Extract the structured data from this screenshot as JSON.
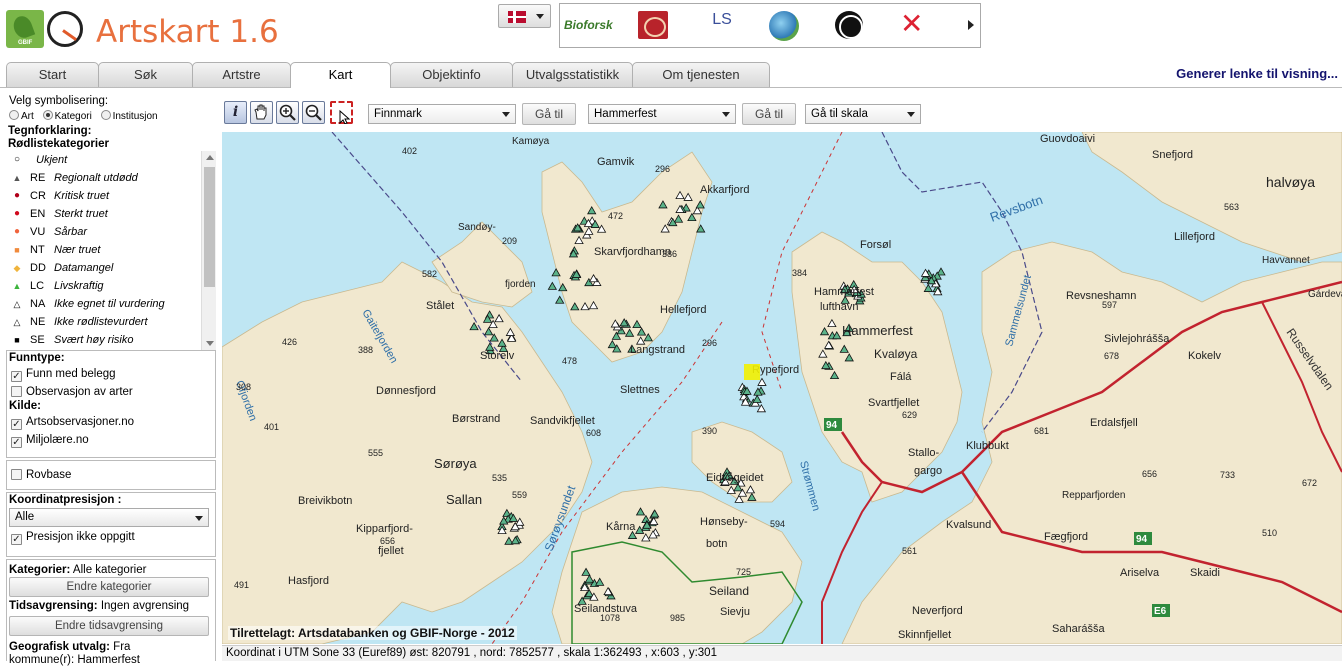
{
  "header": {
    "app_title": "Artskart 1.6",
    "gbif_text": "GBIF",
    "partners_label_bioforsk": "Bioforsk",
    "partners_label_ls": "LS",
    "share_link": "Generer lenke til visning..."
  },
  "tabs": [
    {
      "label": "Start"
    },
    {
      "label": "Søk"
    },
    {
      "label": "Artstre"
    },
    {
      "label": "Kart"
    },
    {
      "label": "Objektinfo"
    },
    {
      "label": "Utvalgsstatistikk"
    },
    {
      "label": "Om tjenesten"
    }
  ],
  "active_tab": "Kart",
  "sidebar": {
    "symbolisering_label": "Velg symbolisering:",
    "radio_art": "Art",
    "radio_kategori": "Kategori",
    "radio_institusjon": "Institusjon",
    "radio_selected": "Kategori",
    "legend_title": "Tegnforklaring:",
    "legend_subtitle": "Rødlistekategorier",
    "legend_items": [
      {
        "code": "",
        "desc": "Ukjent",
        "color": "#ffffff"
      },
      {
        "code": "RE",
        "desc": "Regionalt utdødd",
        "color": "#555555"
      },
      {
        "code": "CR",
        "desc": "Kritisk truet",
        "color": "#b0001a"
      },
      {
        "code": "EN",
        "desc": "Sterkt truet",
        "color": "#d10a1e"
      },
      {
        "code": "VU",
        "desc": "Sårbar",
        "color": "#f0643c"
      },
      {
        "code": "NT",
        "desc": "Nær truet",
        "color": "#f08a3c"
      },
      {
        "code": "DD",
        "desc": "Datamangel",
        "color": "#f0b43c"
      },
      {
        "code": "LC",
        "desc": "Livskraftig",
        "color": "#3cb43c"
      },
      {
        "code": "NA",
        "desc": "Ikke egnet til vurdering",
        "color": "#ffffff"
      },
      {
        "code": "NE",
        "desc": "Ikke rødlistevurdert",
        "color": "#ffffff"
      },
      {
        "code": "SE",
        "desc": "Svært høy risiko",
        "color": "#000000"
      }
    ],
    "funntype_title": "Funntype:",
    "funn_med_belegg": "Funn med belegg",
    "observasjon_av_arter": "Observasjon av arter",
    "kilde_title": "Kilde:",
    "kilde_artsobs": "Artsobservasjoner.no",
    "kilde_miljolare": "Miljolære.no",
    "rovbase": "Rovbase",
    "koordinat_title": "Koordinatpresisjon :",
    "koordinat_value": "Alle",
    "presisjon_ikke_oppgitt": "Presisjon ikke oppgitt",
    "kategorier_label": "Kategorier:",
    "kategorier_value": "Alle kategorier",
    "endre_kategorier": "Endre kategorier",
    "tidsavgrensing_label": "Tidsavgrensing:",
    "tidsavgrensing_value": "Ingen avgrensing",
    "endre_tidsavgrensing": "Endre tidsavgrensing",
    "geografisk_label": "Geografisk utvalg:",
    "geografisk_value": "Fra",
    "kommune_line": "kommune(r): Hammerfest"
  },
  "toolbar": {
    "info_icon_glyph": "i",
    "county_select": "Finnmark",
    "goto1": "Gå til",
    "municipality_select": "Hammerfest",
    "goto2": "Gå til",
    "scale_select": "Gå til skala"
  },
  "map": {
    "credit": "Tilrettelagt: Artsdatabanken og GBIF-Norge - 2012",
    "status": "Koordinat i UTM Sone 33 (Euref89) øst: 820791 , nord: 7852577 , skala 1:362493 , x:603 , y:301",
    "place_labels": {
      "kamoya": "Kamøya",
      "gamvik": "Gamvik",
      "akkarfjord": "Akkarfjord",
      "sandoy": "Sandøy-",
      "fjorden": "fjorden",
      "skarvfjordhamn": "Skarvfjordhamn",
      "hellefjord": "Hellefjord",
      "stalet": "Stålet",
      "langstrand": "Langstrand",
      "storelv": "Storelv",
      "slettnes": "Slettnes",
      "donnesfjord": "Dønnesfjord",
      "borstrand": "Børstrand",
      "sandvikfjellet": "Sandvikfjellet",
      "soroya": "Sørøya",
      "sallan": "Sallan",
      "breivikbotn": "Breivikbotn",
      "kipparfjord": "Kipparfjord-",
      "fjellet": "fjellet",
      "hasfjord": "Hasfjord",
      "hornsvag_sund": "Sørøysundet",
      "eidvageidet": "Eidvågeidet",
      "karna": "Kårna",
      "honseby": "Hønseby-",
      "botn": "botn",
      "seiland": "Seiland",
      "seilandstuva": "Seilandstuva",
      "sievju": "Sievju",
      "forsol": "Forsøl",
      "hammerfest_lh": "Hammerfest",
      "lufthavn": "lufthavn",
      "hammerfest": "Hammerfest",
      "kvaloya": "Kvaløya",
      "fala": "Fálá",
      "rypefjord": "Rypefjord",
      "svartfjellet": "Svartfjellet",
      "stallo": "Stallo-",
      "gargo": "gargo",
      "strommen": "Strømmen",
      "kvalsund": "Kvalsund",
      "klubbukt": "Klubbukt",
      "faegfjord": "Fægfjord",
      "neverfjord": "Neverfjord",
      "skinnfjellet": "Skinnfjellet",
      "ariselva": "Ariselva",
      "skaidi": "Skaidi",
      "repparfjorden": "Repparfjorden",
      "revsbotn": "Revsbotn",
      "revsneshamn": "Revsneshamn",
      "sivlejohrassa": "Sivlejohrášša",
      "erdalsfjell": "Erdalsfjell",
      "kokelv": "Kokelv",
      "snefjord": "Snefjord",
      "lillefjord": "Lillefjord",
      "halvoya": "halvøya",
      "havvannet": "Havvannet",
      "gardevarri": "Gárdeva",
      "russelvdalen": "Russelvdalen",
      "sammelsundet": "Sammelsundet",
      "gaiteljorden": "Gaitefjorden",
      "ofjorden": "Ofjorden",
      "guovdoaivi": "Guovdoaivi",
      "saharassa": "Saharášša",
      "road94": "94",
      "road94b": "94",
      "e6": "E6"
    },
    "elevations": [
      "402",
      "472",
      "296",
      "209",
      "582",
      "386",
      "384",
      "426",
      "388",
      "478",
      "296",
      "308",
      "401",
      "555",
      "608",
      "390",
      "629",
      "597",
      "678",
      "563",
      "681",
      "656",
      "535",
      "559",
      "656",
      "491",
      "594",
      "725",
      "1078",
      "985",
      "561",
      "672",
      "733",
      "510"
    ]
  }
}
